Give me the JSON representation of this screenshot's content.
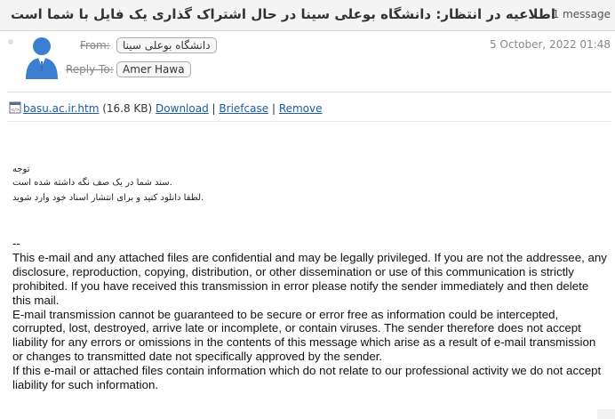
{
  "header": {
    "subject": "اطلاعیه در انتظار: دانشگاه بوعلی سینا در حال اشتراک گذاری یک فایل با شما است",
    "message_count": "1 message"
  },
  "message": {
    "from_label": "From:",
    "from_value": "دانشگاه بوعلی سینا",
    "reply_to_label": "Reply To:",
    "reply_to_value": "Amer Hawa",
    "date": "5 October, 2022 01:48"
  },
  "attachment": {
    "filename": "basu.ac.ir.htm",
    "size": "(16.8 KB)",
    "download_label": "Download",
    "briefcase_label": "Briefcase",
    "remove_label": "Remove",
    "divider": "|",
    "icon": "html-file-icon"
  },
  "body": {
    "fa_line1": "توجه",
    "fa_line2": "سند شما در یک صف نگه داشته شده است.",
    "fa_line3": "لطفا دانلود کنید و برای انتشار اسناد خود وارد شوید.",
    "sig_sep": "--",
    "disclaimer_p1": "This e-mail and any attached files are confidential and may be legally privileged. If you are not the addressee, any disclosure, reproduction, copying, distribution, or other dissemination or use of this communication is strictly prohibited. If you have received this transmission in error please notify the sender immediately and then delete this mail.",
    "disclaimer_p2": "E-mail transmission cannot be guaranteed to be secure or error free as information could be intercepted, corrupted, lost, destroyed, arrive late or incomplete, or contain viruses. The sender therefore does not accept liability for any errors or omissions in the contents of this message which arise as a result of e-mail transmission or changes to transmitted date not specifically approved by the sender.",
    "disclaimer_p3": "If this e-mail or attached files contain information which do not relate to our professional activity we do not accept liability for such information."
  },
  "colors": {
    "link": "#1a5aa6",
    "avatar": "#3a7fd0",
    "header_bg": "#f4f4f4"
  }
}
